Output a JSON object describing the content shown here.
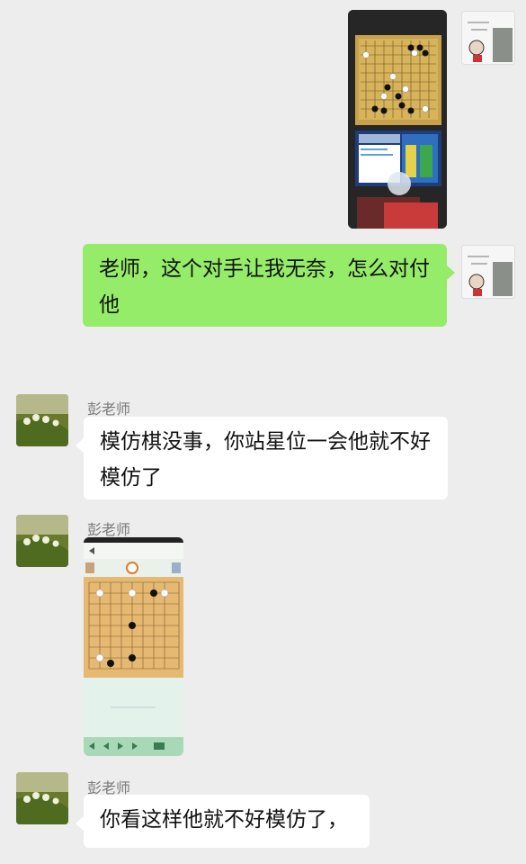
{
  "messages": [
    {
      "id": "m1",
      "from": "me",
      "type": "image",
      "image": "go-board-photo"
    },
    {
      "id": "m2",
      "from": "me",
      "type": "text",
      "text": "老师，这个对手让我无奈，怎么对付他"
    },
    {
      "id": "m3",
      "from": "other",
      "sender": "彭老师",
      "type": "text",
      "text": "模仿棋没事，你站星位一会他就不好模仿了"
    },
    {
      "id": "m4",
      "from": "other",
      "sender": "彭老师",
      "type": "image",
      "image": "go-app-screenshot"
    },
    {
      "id": "m5",
      "from": "other",
      "sender": "彭老师",
      "type": "text",
      "text": "你看这样他就不好模仿了，"
    }
  ],
  "colors": {
    "bubble_me": "#95ec69",
    "bubble_other": "#ffffff",
    "background": "#ededed",
    "name": "#7a7a7a"
  }
}
